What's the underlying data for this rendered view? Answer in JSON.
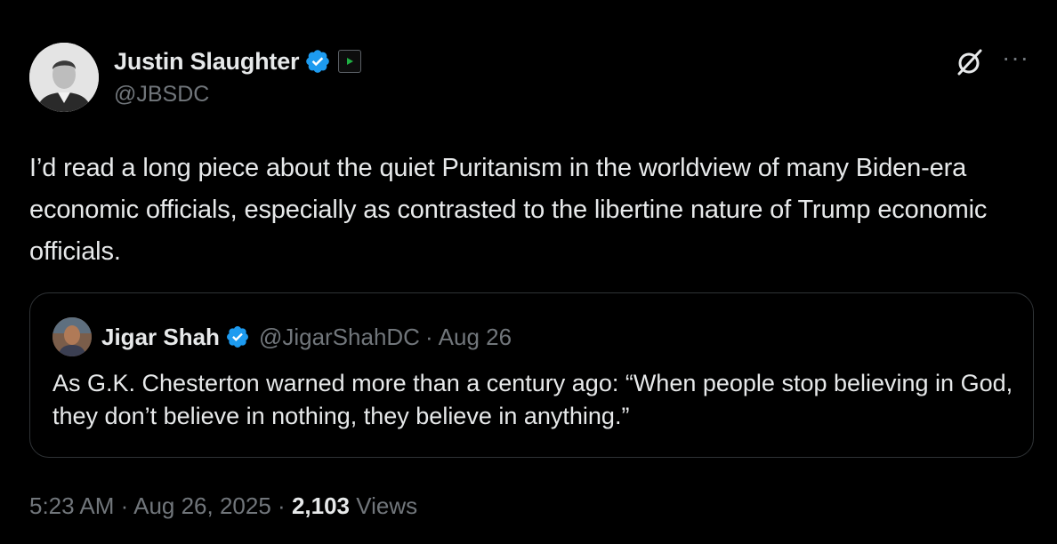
{
  "author": {
    "name": "Justin Slaughter",
    "handle": "@JBSDC"
  },
  "tweet": {
    "text": "I’d read a long piece about the quiet Puritanism in the worldview of many Biden-era economic officials, especially as contrasted to the libertine nature of Trump economic officials."
  },
  "quoted": {
    "name": "Jigar Shah",
    "handle": "@JigarShahDC",
    "separator": "·",
    "date": "Aug 26",
    "text": "As G.K. Chesterton warned more than a century ago: “When people stop believing in God, they don’t believe in nothing, they believe in anything.”"
  },
  "meta": {
    "time": "5:23 AM",
    "sep1": "·",
    "date": "Aug 26, 2025",
    "sep2": "·",
    "views_count": "2,103",
    "views_label": "Views"
  },
  "menu": {
    "more_label": "···"
  },
  "colors": {
    "background": "#000000",
    "text": "#e7e9ea",
    "muted": "#71767b",
    "verified": "#1d9bf0",
    "border": "#2f3336"
  },
  "icons": {
    "verified": "verified-badge-icon",
    "affiliation": "affiliation-badge-icon",
    "grok": "grok-icon",
    "more": "more-icon"
  }
}
